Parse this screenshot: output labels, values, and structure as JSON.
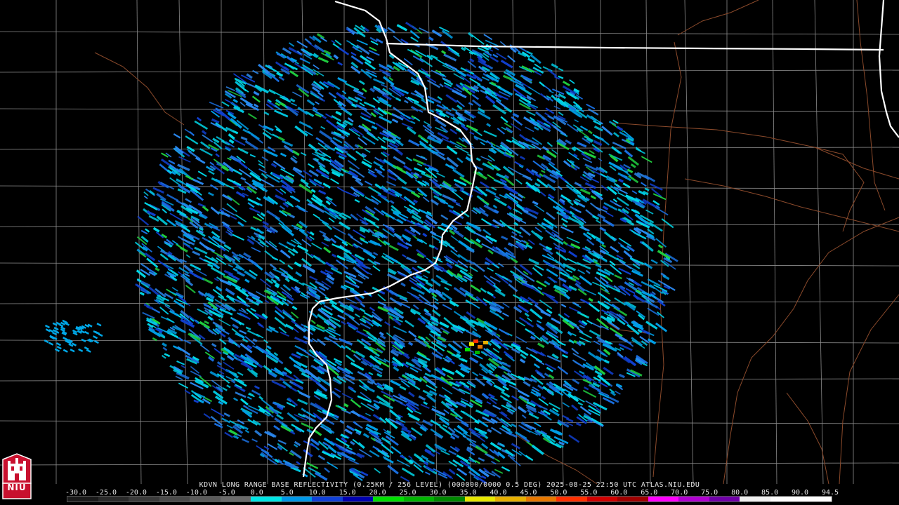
{
  "title": "KDVN LONG RANGE BASE REFLECTIVITY (0.25KM / 256 LEVEL) (000000/0000 0.5 DEG) 2025-08-25 22:50 UTC  ATLAS.NIU.EDU",
  "logo": {
    "icon": "niu-castle-logo",
    "text": "NIU"
  },
  "legend": {
    "labels": [
      "-30.0",
      "-25.0",
      "-20.0",
      "-15.0",
      "-10.0",
      "-5.0",
      "0.0",
      "5.0",
      "10.0",
      "15.0",
      "20.0",
      "25.0",
      "30.0",
      "35.0",
      "40.0",
      "45.0",
      "50.0",
      "55.0",
      "60.0",
      "65.0",
      "70.0",
      "75.0",
      "80.0",
      "85.0",
      "90.0",
      "94.5"
    ],
    "colors": [
      "#1a1a1a",
      "#2a2a2a",
      "#3a3a3a",
      "#4a4a4a",
      "#5a5a5a",
      "#6a6a6a",
      "#00e5e5",
      "#0098e8",
      "#1040d8",
      "#0000b0",
      "#00e000",
      "#00b400",
      "#008800",
      "#e8e800",
      "#e8b000",
      "#e87800",
      "#ff3000",
      "#d00000",
      "#a00000",
      "#ff00ff",
      "#b000d0",
      "#7000a8",
      "#f0f0f0",
      "#ffffff",
      "#ffffff"
    ]
  },
  "map": {
    "radar_site": "KDVN",
    "colors": {
      "state_border": "#ffffff",
      "county_line": "#8c8c8c",
      "highway": "#8b4a2b",
      "background": "#000000"
    }
  }
}
